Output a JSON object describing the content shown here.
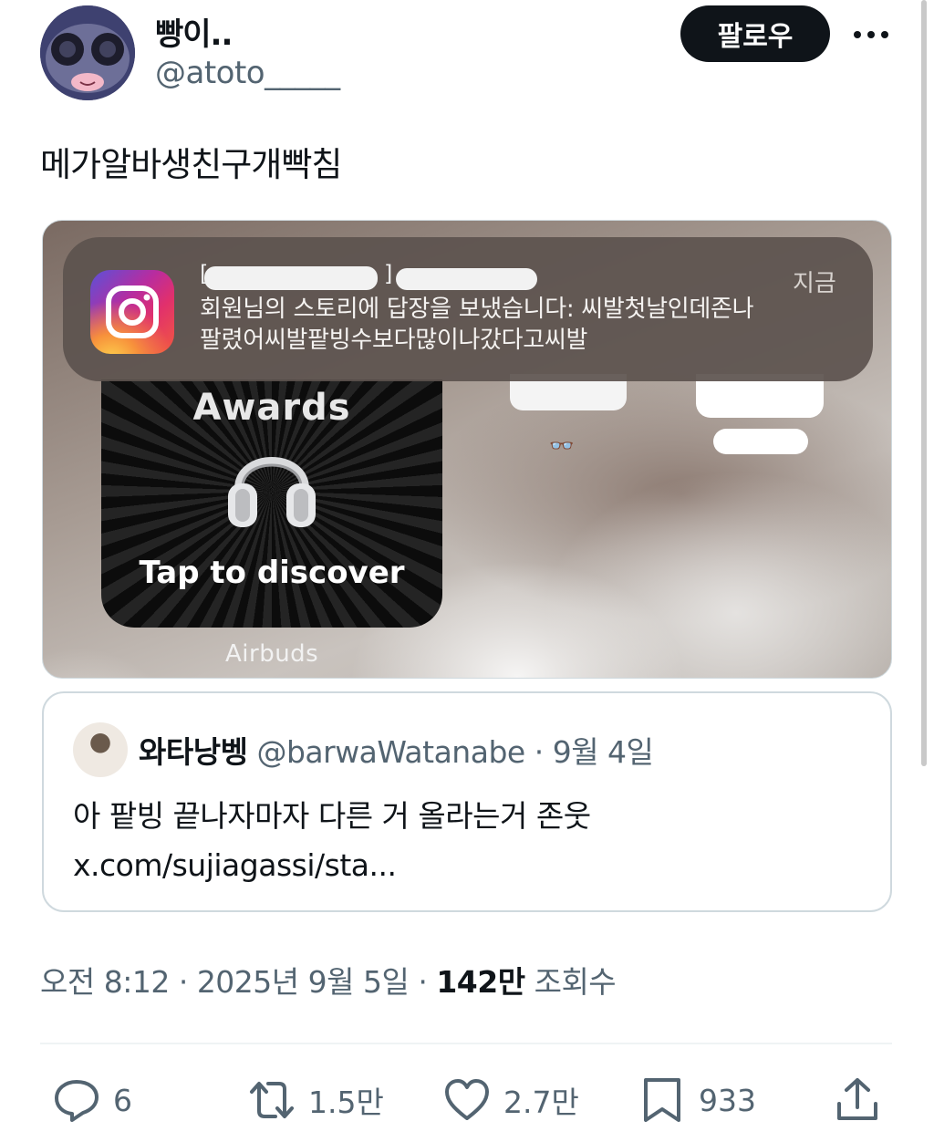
{
  "author": {
    "display_name": "빵이..",
    "handle": "@atoto_____",
    "follow_label": "팔로우",
    "more_icon": "more-icon"
  },
  "tweet": {
    "text": "메가알바생친구개빡침"
  },
  "media": {
    "notification": {
      "app_icon": "instagram-icon",
      "title_left_bracket": "[",
      "title_right_bracket": "]",
      "time": "지금",
      "body_line1": "회원님의 스토리에 답장을 보냈습니다: 씨발첫날인데존나",
      "body_line2": "팔렸어씨발팥빙수보다많이나갔다고씨발"
    },
    "widget": {
      "title": "Awards",
      "icon": "headphones-icon",
      "cta": "Tap to discover",
      "caption": "Airbuds"
    },
    "glasses_emoji": "👓"
  },
  "quote": {
    "name": "와타낭벵",
    "handle": "@barwaWatanabe",
    "dot": "·",
    "date": "9월 4일",
    "text_line1": "아 팥빙 끝나자마자 다른 거 올라는거 존웃",
    "text_line2": "x.com/sujiagassi/sta..."
  },
  "meta": {
    "time": "오전 8:12",
    "sep1": " · ",
    "date": "2025년 9월 5일",
    "sep2": " · ",
    "views": "142만",
    "views_label": " 조회수"
  },
  "actions": {
    "reply_count": "6",
    "retweet_count": "1.5만",
    "like_count": "2.7만",
    "bookmark_count": "933"
  },
  "colors": {
    "text": "#0f1419",
    "secondary": "#536471",
    "border": "#cfd9de",
    "follow_bg": "#0f1419"
  }
}
